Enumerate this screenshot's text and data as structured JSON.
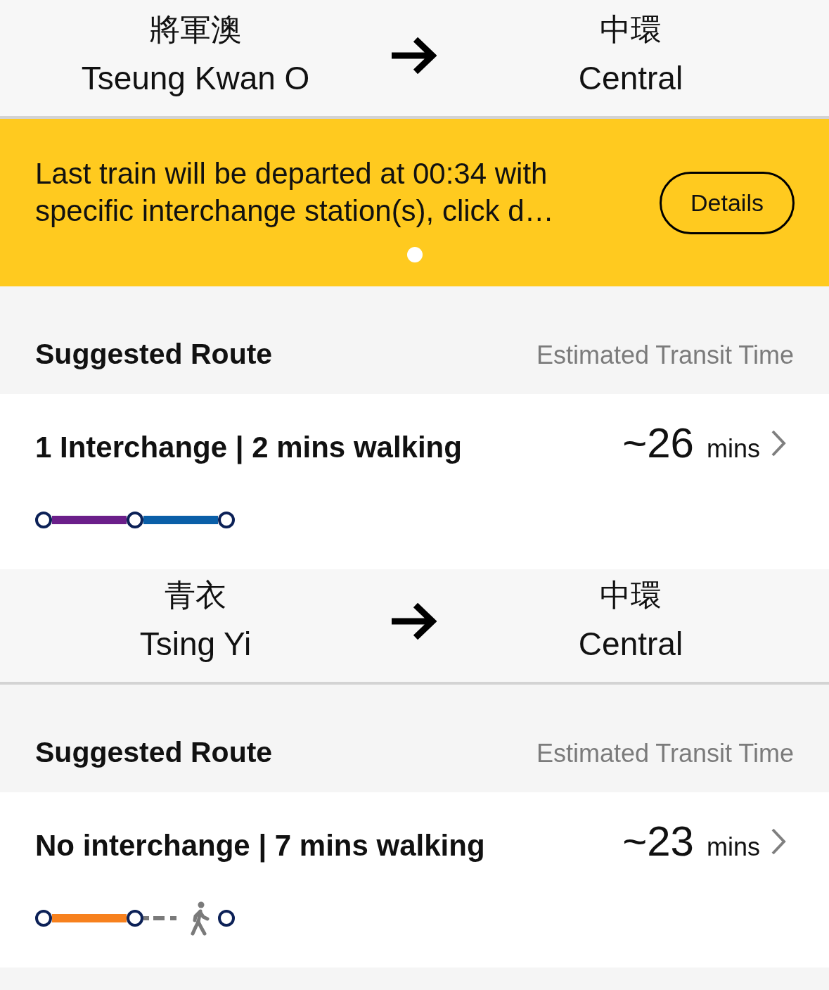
{
  "journeys": [
    {
      "from": {
        "name_zh": "將軍澳",
        "name_en": "Tseung Kwan O"
      },
      "to": {
        "name_zh": "中環",
        "name_en": "Central"
      },
      "notice": {
        "text": "Last train will be departed at 00:34 with specific interchange station(s), click d…",
        "button": "Details",
        "pages": [
          {
            "selected": true
          }
        ]
      },
      "section": {
        "title": "Suggested Route",
        "time_label": "Estimated Transit Time"
      },
      "route": {
        "summary": "1 Interchange | 2 mins walking",
        "time": "~26",
        "unit": "mins",
        "legs": [
          {
            "kind": "line",
            "color": "#6b1f8a"
          },
          {
            "kind": "line",
            "color": "#0a5fa8"
          }
        ]
      }
    },
    {
      "from": {
        "name_zh": "青衣",
        "name_en": "Tsing Yi"
      },
      "to": {
        "name_zh": "中環",
        "name_en": "Central"
      },
      "section": {
        "title": "Suggested Route",
        "time_label": "Estimated Transit Time"
      },
      "route": {
        "summary": "No interchange | 7 mins walking",
        "time": "~23",
        "unit": "mins",
        "legs": [
          {
            "kind": "line",
            "color": "#f7811e"
          },
          {
            "kind": "walk"
          }
        ]
      }
    }
  ]
}
